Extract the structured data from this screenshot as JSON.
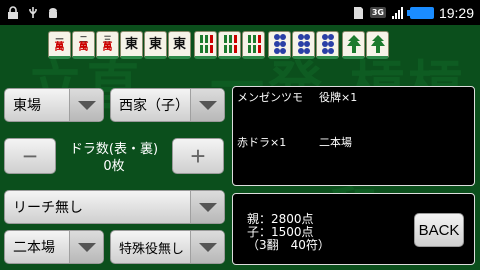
{
  "status_bar": {
    "time": "19:29",
    "network": "3G"
  },
  "background_text": [
    "立直",
    "一発",
    "槓槓",
    "和"
  ],
  "tiles": [
    {
      "top": "一",
      "suit": "萬"
    },
    {
      "top": "二",
      "suit": "萬"
    },
    {
      "top": "三",
      "suit": "萬"
    },
    {
      "top": "東",
      "suit": ""
    },
    {
      "top": "東",
      "suit": ""
    },
    {
      "top": "東",
      "suit": ""
    },
    {
      "top": "",
      "suit": "bamboo"
    },
    {
      "top": "",
      "suit": "bamboo"
    },
    {
      "top": "",
      "suit": "bamboo"
    },
    {
      "top": "",
      "suit": "circle"
    },
    {
      "top": "",
      "suit": "circle"
    },
    {
      "top": "",
      "suit": "circle"
    },
    {
      "top": "",
      "suit": "bamboo-dragon"
    },
    {
      "top": "",
      "suit": "bamboo-dragon"
    }
  ],
  "controls": {
    "round_wind": "東場",
    "seat_wind": "西家（子）",
    "dora_label": "ドラ数(表・裏)",
    "dora_value": "0枚",
    "minus": "−",
    "plus": "+",
    "riichi": "リーチ無し",
    "honba": "二本場",
    "special_yaku": "特殊役無し"
  },
  "yaku_panel": {
    "items": [
      "メンゼンツモ",
      "役牌×1",
      "赤ドラ×1",
      "二本場"
    ]
  },
  "result_panel": {
    "line1": "親：2800点",
    "line2": "子：1500点",
    "line3": "（3翻　40符）",
    "back_label": "BACK"
  }
}
